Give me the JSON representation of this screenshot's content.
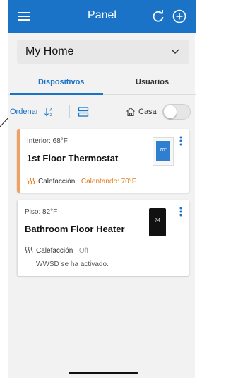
{
  "header": {
    "title": "Panel",
    "menu_icon": "hamburger-menu-icon",
    "refresh_icon": "refresh-icon",
    "add_icon": "add-circle-icon",
    "color": "#1a73c7"
  },
  "home_selector": {
    "value": "My Home",
    "icon": "chevron-down-icon"
  },
  "tabs": [
    {
      "label": "Dispositivos",
      "active": true
    },
    {
      "label": "Usuarios",
      "active": false
    }
  ],
  "toolbar": {
    "sort_label": "Ordenar",
    "sort_icon": "sort-icon",
    "list_icon": "list-view-icon",
    "home_icon": "house-icon",
    "home_toggle_label": "Casa",
    "home_toggle_on": false
  },
  "devices": [
    {
      "temp_label": "Interior: 68°F",
      "name": "1st Floor Thermostat",
      "mode": "Calefacción",
      "state": "Calentando: 70°F",
      "state_color": "#e07b1a",
      "accent": "#f0a060",
      "display_value": "70°"
    },
    {
      "temp_label": "Piso: 82°F",
      "name": "Bathroom Floor Heater",
      "mode": "Calefacción",
      "state": "Off",
      "note": "WWSD se ha activado.",
      "display_value": "74"
    }
  ]
}
